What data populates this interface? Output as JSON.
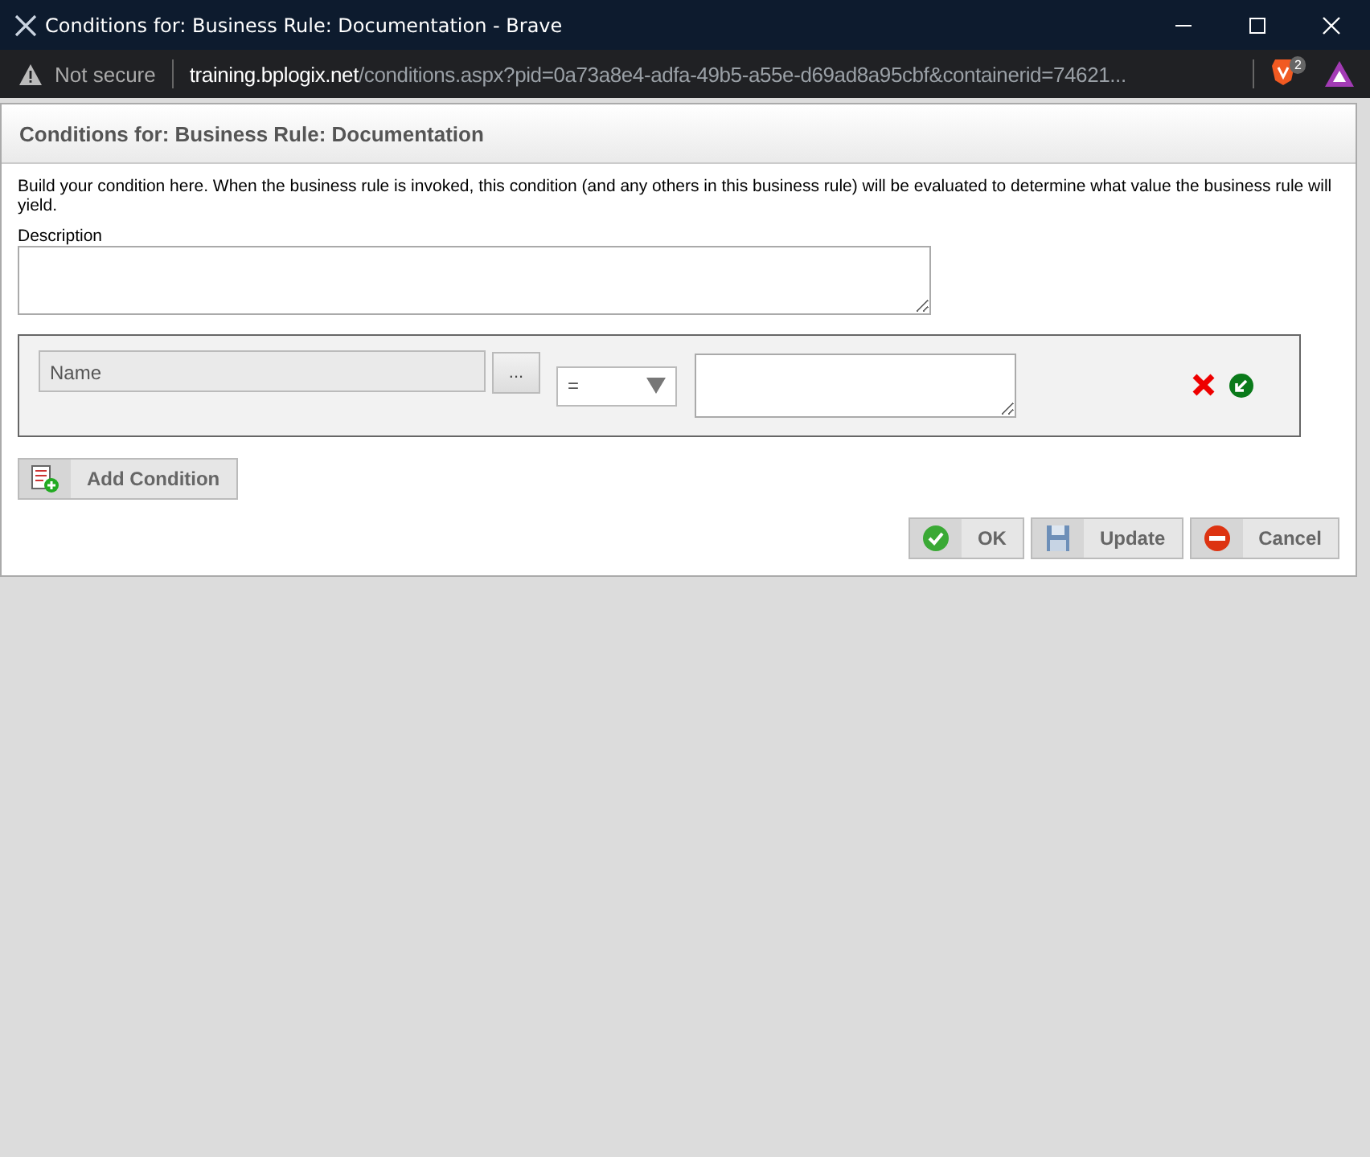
{
  "window": {
    "title": "Conditions for: Business Rule: Documentation - Brave"
  },
  "address_bar": {
    "security": "Not secure",
    "host": "training.bplogix.net",
    "path": "/conditions.aspx?pid=0a73a8e4-adfa-49b5-a55e-d69ad8a95cbf&containerid=74621...",
    "shield_count": "2"
  },
  "dialog": {
    "title": "Conditions for: Business Rule: Documentation",
    "intro": "Build your condition here. When the business rule is invoked, this condition (and any others in this business rule) will be evaluated to determine what value the business rule will yield.",
    "description_label": "Description",
    "condition": {
      "field": "Name",
      "browse": "...",
      "operator": "="
    },
    "add_button": "Add Condition",
    "actions": [
      {
        "kind": "ok",
        "label": "OK"
      },
      {
        "kind": "update",
        "label": "Update"
      },
      {
        "kind": "cancel",
        "label": "Cancel"
      }
    ]
  }
}
